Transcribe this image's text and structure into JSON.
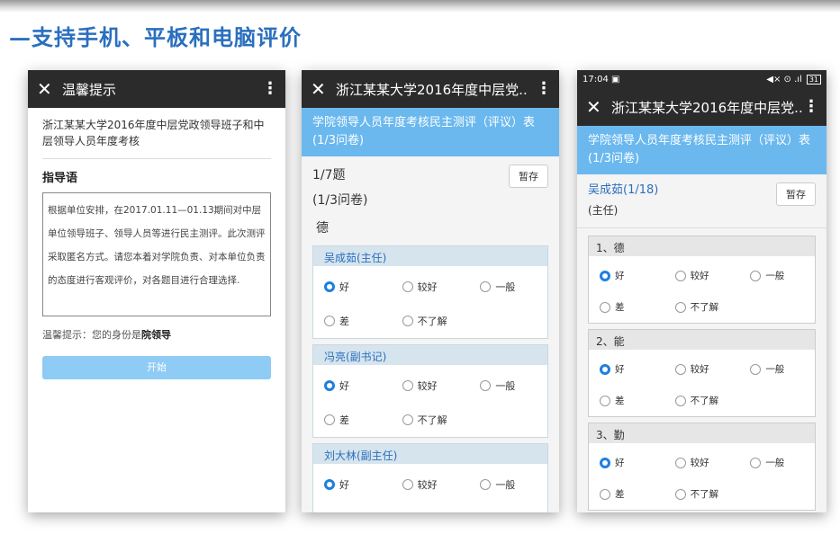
{
  "headline": "—支持手机、平板和电脑评价",
  "phone1": {
    "title": "温馨提示",
    "subject": "浙江某某大学2016年度中层党政领导班子和中层领导人员年度考核",
    "guide_title": "指导语",
    "guide_text": "根据单位安排，在2017.01.11—01.13期间对中层单位领导班子、领导人员等进行民主测评。此次测评采取匿名方式。请您本着对学院负责、对本单位负责的态度进行客观评价，对各题目进行合理选择.",
    "tip_label": "温馨提示：您的身份是",
    "tip_identity": "院领导",
    "start_label": "开始"
  },
  "phone2": {
    "title": "浙江某某大学2016年度中层党..",
    "header": "学院领导人员年度考核民主测评（评议）表 (1/3问卷)",
    "progress": "1/7题",
    "questionnaire": "(1/3问卷)",
    "save_label": "暂存",
    "category": "德",
    "people": [
      {
        "name": "吴成茹(主任)",
        "selected": 0
      },
      {
        "name": "冯亮(副书记)",
        "selected": 0
      },
      {
        "name": "刘大林(副主任)",
        "selected": 0
      }
    ]
  },
  "phone3": {
    "status": {
      "time": "17:04",
      "right": "◀× ⊙ .ıl",
      "battery": "31"
    },
    "title": "浙江某某大学2016年度中层党..",
    "header": "学院领导人员年度考核民主测评（评议）表 (1/3问卷)",
    "person": "吴成茹(1/18)",
    "role": "(主任)",
    "save_label": "暂存",
    "categories": [
      {
        "name": "1、德",
        "selected": 0
      },
      {
        "name": "2、能",
        "selected": 0
      },
      {
        "name": "3、勤",
        "selected": 0
      }
    ]
  },
  "options": [
    "好",
    "较好",
    "一般",
    "差",
    "不了解"
  ]
}
